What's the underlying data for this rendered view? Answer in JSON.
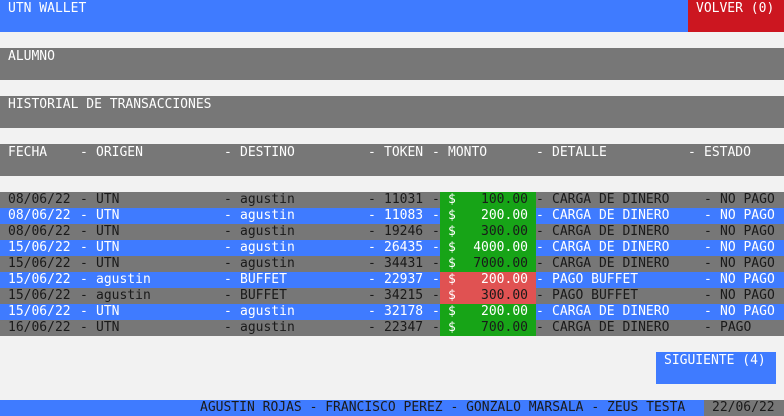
{
  "header": {
    "title": "UTN WALLET",
    "back_button": "VOLVER (0)",
    "color": "#3f7bff",
    "back_color": "#cc1620"
  },
  "user_label": "ALUMNO",
  "section_title": "HISTORIAL DE TRANSACCIONES",
  "columns": {
    "fecha": "FECHA",
    "origen": "ORIGEN",
    "destino": "DESTINO",
    "token": "TOKEN",
    "monto": "MONTO",
    "detalle": "DETALLE",
    "estado": "ESTADO"
  },
  "transactions": [
    {
      "fecha": "08/06/22",
      "origen": "UTN",
      "destino": "agustin",
      "token": "11031",
      "monto": "100.00",
      "detalle": "CARGA DE DINERO",
      "estado": "NO PAGO",
      "amount_color": "#17a417"
    },
    {
      "fecha": "08/06/22",
      "origen": "UTN",
      "destino": "agustin",
      "token": "11083",
      "monto": "200.00",
      "detalle": "CARGA DE DINERO",
      "estado": "NO PAGO",
      "amount_color": "#17a417"
    },
    {
      "fecha": "08/06/22",
      "origen": "UTN",
      "destino": "agustin",
      "token": "19246",
      "monto": "300.00",
      "detalle": "CARGA DE DINERO",
      "estado": "NO PAGO",
      "amount_color": "#17a417"
    },
    {
      "fecha": "15/06/22",
      "origen": "UTN",
      "destino": "agustin",
      "token": "26435",
      "monto": "4000.00",
      "detalle": "CARGA DE DINERO",
      "estado": "NO PAGO",
      "amount_color": "#17a417"
    },
    {
      "fecha": "15/06/22",
      "origen": "UTN",
      "destino": "agustin",
      "token": "34431",
      "monto": "7000.00",
      "detalle": "CARGA DE DINERO",
      "estado": "NO PAGO",
      "amount_color": "#17a417"
    },
    {
      "fecha": "15/06/22",
      "origen": "agustin",
      "destino": "BUFFET",
      "token": "22937",
      "monto": "200.00",
      "detalle": "PAGO BUFFET",
      "estado": "NO PAGO",
      "amount_color": "#e05252"
    },
    {
      "fecha": "15/06/22",
      "origen": "agustin",
      "destino": "BUFFET",
      "token": "34215",
      "monto": "300.00",
      "detalle": "PAGO BUFFET",
      "estado": "NO PAGO",
      "amount_color": "#e05252"
    },
    {
      "fecha": "15/06/22",
      "origen": "UTN",
      "destino": "agustin",
      "token": "32178",
      "monto": "200.00",
      "detalle": "CARGA DE DINERO",
      "estado": "NO PAGO",
      "amount_color": "#17a417"
    },
    {
      "fecha": "16/06/22",
      "origen": "UTN",
      "destino": "agustin",
      "token": "22347",
      "monto": "700.00",
      "detalle": "CARGA DE DINERO",
      "estado": "PAGO",
      "amount_color": "#17a417"
    }
  ],
  "next_button": "SIGUIENTE (4)",
  "footer": {
    "authors": "AGUSTIN ROJAS - FRANCISCO PEREZ - GONZALO MARSALA - ZEUS TESTA",
    "date": "22/06/22"
  }
}
